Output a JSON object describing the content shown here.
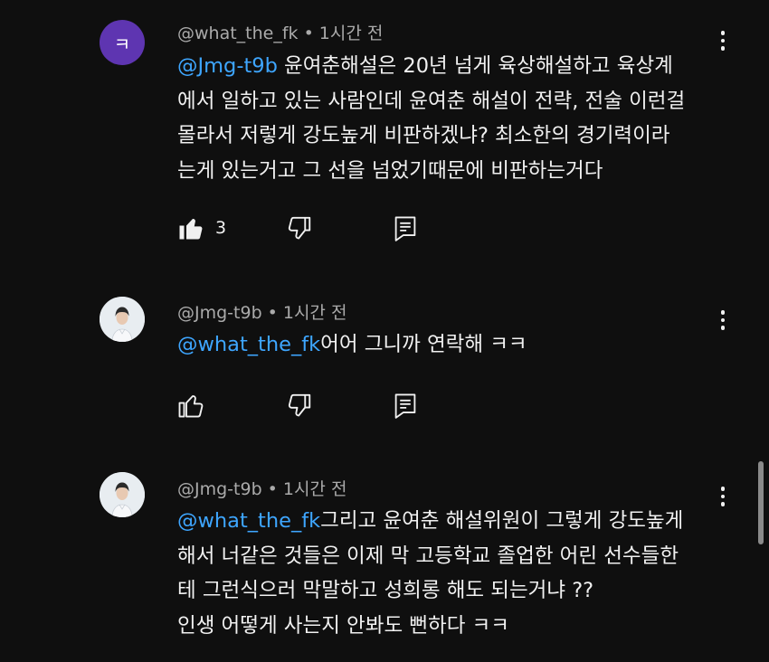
{
  "comments": [
    {
      "avatar_letter": "ㅋ",
      "author": "@what_the_fk",
      "dot": "•",
      "time": "1시간 전",
      "mention": "@Jmg-t9b",
      "lines": [
        " 윤여춘해설은 20년 넘게 육상해설하고 육상계",
        "에서 일하고 있는 사람인데 윤여춘 해설이 전략, 전술 이런걸",
        "몰라서 저렇게 강도높게 비판하겠냐? 최소한의 경기력이라",
        "는게 있는거고 그 선을 넘었기때문에 비판하는거다"
      ],
      "likes": "3",
      "like_filled": true
    },
    {
      "author": "@Jmg-t9b",
      "dot": "•",
      "time": "1시간 전",
      "mention": "@what_the_fk",
      "lines": [
        "어어 그니까 연락해 ㅋㅋ"
      ],
      "likes": "",
      "like_filled": false
    },
    {
      "author": "@Jmg-t9b",
      "dot": "•",
      "time": "1시간 전",
      "mention": "@what_the_fk",
      "lines": [
        "그리고 윤여춘 해설위원이 그렇게 강도높게",
        "해서 너같은 것들은 이제 막 고등학교 졸업한 어린 선수들한",
        "테 그런식으러 막말하고 성희롱 해도 되는거냐 ??",
        "인생 어떻게 사는지 안봐도 뻔하다 ㅋㅋ"
      ]
    }
  ],
  "icons": {
    "like": "thumbs-up-icon",
    "dislike": "thumbs-down-icon",
    "reply": "reply-comment-icon",
    "more": "more-vert-icon"
  },
  "colors": {
    "background": "#0f0f0f",
    "mention": "#3ea6ff",
    "avatar_purple": "#5e35b1",
    "meta_text": "#aaaaaa"
  }
}
